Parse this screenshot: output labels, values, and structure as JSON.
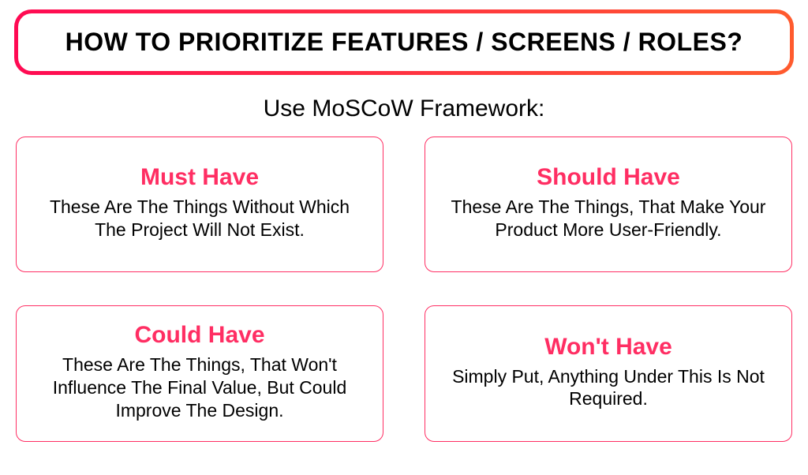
{
  "header": {
    "title": "HOW TO PRIORITIZE FEATURES / SCREENS / ROLES?"
  },
  "subtitle": "Use MoSCoW Framework:",
  "cards": [
    {
      "title": "Must Have",
      "desc": "These Are The Things Without Which The Project Will Not Exist."
    },
    {
      "title": "Should Have",
      "desc": "These Are The Things, That Make Your Product More User-Friendly."
    },
    {
      "title": "Could Have",
      "desc": "These Are The Things, That Won't Influence The Final Value, But Could Improve The Design."
    },
    {
      "title": "Won't Have",
      "desc": "Simply Put, Anything Under This Is Not Required."
    }
  ],
  "colors": {
    "accent": "#ff2e63",
    "gradient_start": "#ff0a53",
    "gradient_end": "#ff5b2e"
  }
}
